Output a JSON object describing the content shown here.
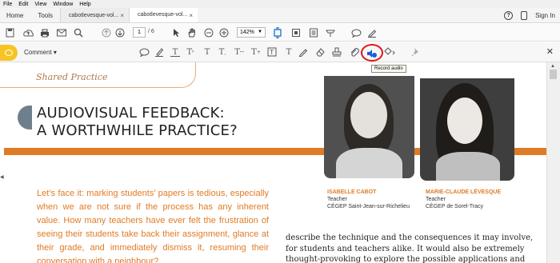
{
  "menu": [
    "File",
    "Edit",
    "View",
    "Window",
    "Help"
  ],
  "tabs": {
    "home": "Home",
    "tools": "Tools",
    "documents": [
      {
        "label": "cabotlevesque-vol...",
        "active": false
      },
      {
        "label": "cabotlevesque-vol...",
        "active": true
      }
    ],
    "close_glyph": "×",
    "sign_in": "Sign In"
  },
  "toolbar": {
    "current_page": "1",
    "page_total": "/ 6",
    "zoom": "142%"
  },
  "comment_bar": {
    "label": "Comment",
    "tooltip": "Record audio",
    "accent_color": "#f6c423",
    "highlight_color": "#e01515",
    "tools": [
      "sticky-note-icon",
      "highlight-icon",
      "underline-text-icon",
      "strikethrough-text-icon",
      "replace-text-icon",
      "insert-text-icon",
      "text-correction-icon",
      "add-text-icon",
      "text-box-icon",
      "pencil-icon",
      "eraser-icon",
      "stamp-icon",
      "attach-file-icon",
      "record-audio-icon",
      "drawing-tools-icon",
      "pin-icon"
    ]
  },
  "document": {
    "section": "Shared Practice",
    "title_lines": [
      "AUDIOVISUAL FEEDBACK:",
      "A WORTHWHILE PRACTICE?"
    ],
    "accent_color": "#e07b25",
    "people": [
      {
        "name": "ISABELLE CABOT",
        "role": "Teacher",
        "affiliation": "CÉGEP Saint-Jean-sur-Richelieu"
      },
      {
        "name": "MARIE-CLAUDE LÉVESQUE",
        "role": "Teacher",
        "affiliation": "CÉGEP de Sorel-Tracy"
      }
    ],
    "lead_paragraph": "Let’s face it: marking students’ papers is tedious, especially when we are not sure if the process has any inherent value. How many teachers have ever felt the frustration of seeing their students take back their assignment, glance at their grade, and immediately dismiss it, resuming their conversation with a neighbour?",
    "body_lines": [
      "describe the technique and the consequences it may involve,",
      "for students and teachers alike. It would also be extremely",
      "thought-provoking to explore the possible applications and"
    ]
  }
}
